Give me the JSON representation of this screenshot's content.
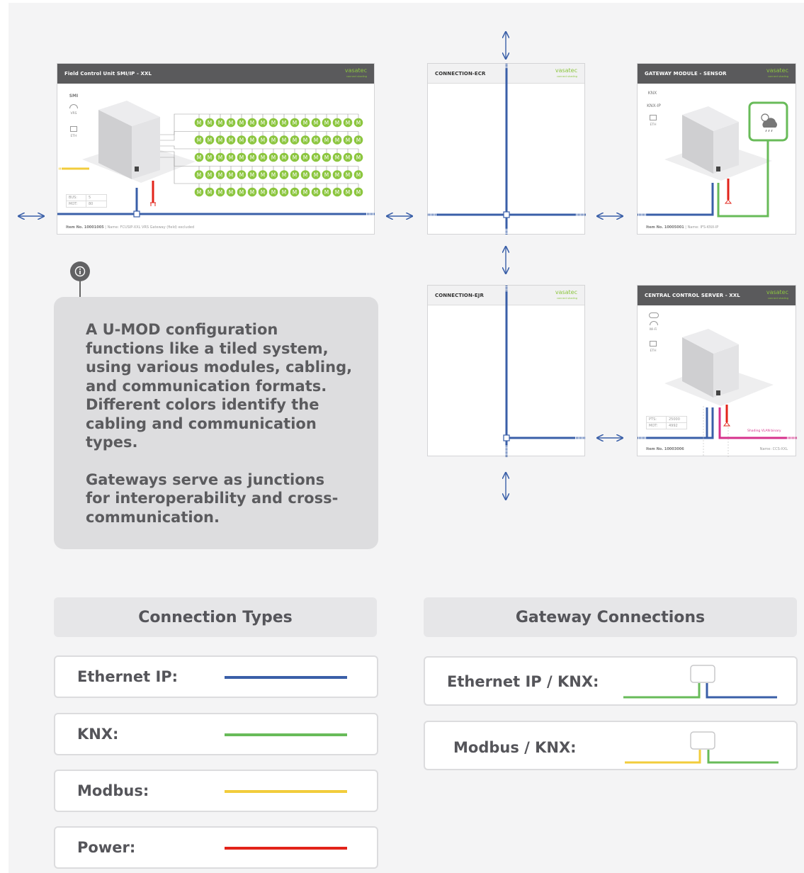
{
  "colors": {
    "ethernet": "#3a5fa8",
    "knx": "#68bb59",
    "modbus": "#f2cc3c",
    "power": "#e2231a",
    "shading": "#d6318c",
    "brand": "#8cc63f",
    "motor": "#8cc63f"
  },
  "brand": {
    "name": "vasatec",
    "tagline": "connect shading"
  },
  "tiles": {
    "fcu": {
      "title": "Field Control Unit SMI/IP - XXL",
      "side": [
        "SMI",
        "VRS",
        "ETH"
      ],
      "stats": [
        {
          "label": "BUS:",
          "value": "5"
        },
        {
          "label": "MOT:",
          "value": "80"
        }
      ],
      "motor_label": "M",
      "footer_item": "Item No. 10001005",
      "footer_rest": "Name: FCUSIP-XXL    VRS Gateway (field) excluded"
    },
    "ecr": {
      "title": "CONNECTION-ECR"
    },
    "gateway": {
      "title": "GATEWAY MODULE - SENSOR",
      "side": [
        "KNX",
        "KNX-IP",
        "ETH"
      ],
      "weather_icon": "cloud-rain-sun-icon",
      "footer_item": "Item No. 10005001",
      "footer_rest": "Name: IFS-KNX-IP"
    },
    "ejr": {
      "title": "CONNECTION-EJR"
    },
    "server": {
      "title": "CENTRAL CONTROL SERVER - XXL",
      "side": [
        "Wi-Fi",
        "ETH"
      ],
      "stats": [
        {
          "label": "PTS:",
          "value": "25000"
        },
        {
          "label": "MOT:",
          "value": "4992"
        }
      ],
      "shading_label": "Shading VLAN binary",
      "footer_item": "Item No. 10003006",
      "footer_rest": "Name: CCS-XXL"
    }
  },
  "callout": {
    "paragraph1": "A U-MOD configuration functions like a tiled system, using various modules, cabling, and communication formats. Different colors identify the cabling and communication types.",
    "paragraph2": "Gateways serve as junctions for interoperability and cross-communication."
  },
  "connection_types": {
    "title": "Connection Types",
    "items": [
      {
        "label": "Ethernet IP:",
        "color": "#3a5fa8"
      },
      {
        "label": "KNX:",
        "color": "#68bb59"
      },
      {
        "label": "Modbus:",
        "color": "#f2cc3c"
      },
      {
        "label": "Power:",
        "color": "#e2231a"
      }
    ]
  },
  "gateway_connections": {
    "title": "Gateway Connections",
    "items": [
      {
        "label": "Ethernet IP / KNX:",
        "left_color": "#68bb59",
        "right_color": "#3a5fa8"
      },
      {
        "label": "Modbus / KNX:",
        "left_color": "#f2cc3c",
        "right_color": "#68bb59"
      }
    ]
  }
}
